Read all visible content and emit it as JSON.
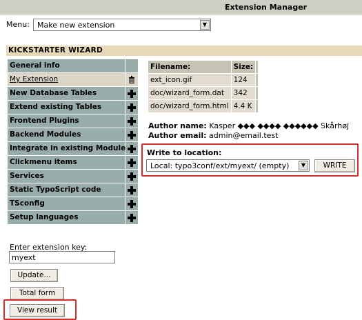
{
  "header": {
    "title": "Extension Manager"
  },
  "menu": {
    "label": "Menu:",
    "selected": "Make new extension"
  },
  "wizard": {
    "title": "KICKSTARTER WIZARD"
  },
  "sidebar": {
    "items": [
      {
        "label": "General info",
        "icon": "none"
      },
      {
        "label": "My Extension",
        "icon": "trash-icon",
        "active": true
      },
      {
        "label": "New Database Tables",
        "icon": "plus-icon"
      },
      {
        "label": "Extend existing Tables",
        "icon": "plus-icon"
      },
      {
        "label": "Frontend Plugins",
        "icon": "plus-icon"
      },
      {
        "label": "Backend Modules",
        "icon": "plus-icon"
      },
      {
        "label": "Integrate in existing Modules",
        "icon": "plus-icon"
      },
      {
        "label": "Clickmenu items",
        "icon": "plus-icon"
      },
      {
        "label": "Services",
        "icon": "plus-icon"
      },
      {
        "label": "Static TypoScript code",
        "icon": "plus-icon"
      },
      {
        "label": "TSconfig",
        "icon": "plus-icon"
      },
      {
        "label": "Setup languages",
        "icon": "plus-icon"
      }
    ]
  },
  "files": {
    "headers": [
      "Filename:",
      "Size:"
    ],
    "rows": [
      [
        "ext_icon.gif",
        "124"
      ],
      [
        "doc/wizard_form.dat",
        "342"
      ],
      [
        "doc/wizard_form.html",
        "4.4 K"
      ]
    ]
  },
  "author": {
    "name_label": "Author name:",
    "name": "Kasper ◆◆◆ ◆◆◆◆ ◆◆◆◆◆◆ Skårhøj",
    "email_label": "Author email:",
    "email": "admin@email.test"
  },
  "write": {
    "label": "Write to location:",
    "location": "Local: typo3conf/ext/myext/ (empty)",
    "button": "WRITE"
  },
  "extension_key": {
    "label": "Enter extension key:",
    "value": "myext"
  },
  "buttons": {
    "update": "Update...",
    "total_form": "Total form",
    "view_result": "View result"
  },
  "colors": {
    "highlight": "#d52c2c",
    "nav_bg": "#98adaa",
    "header_bg": "#e7d9b8",
    "topbar_bg": "#cfcfc3"
  }
}
